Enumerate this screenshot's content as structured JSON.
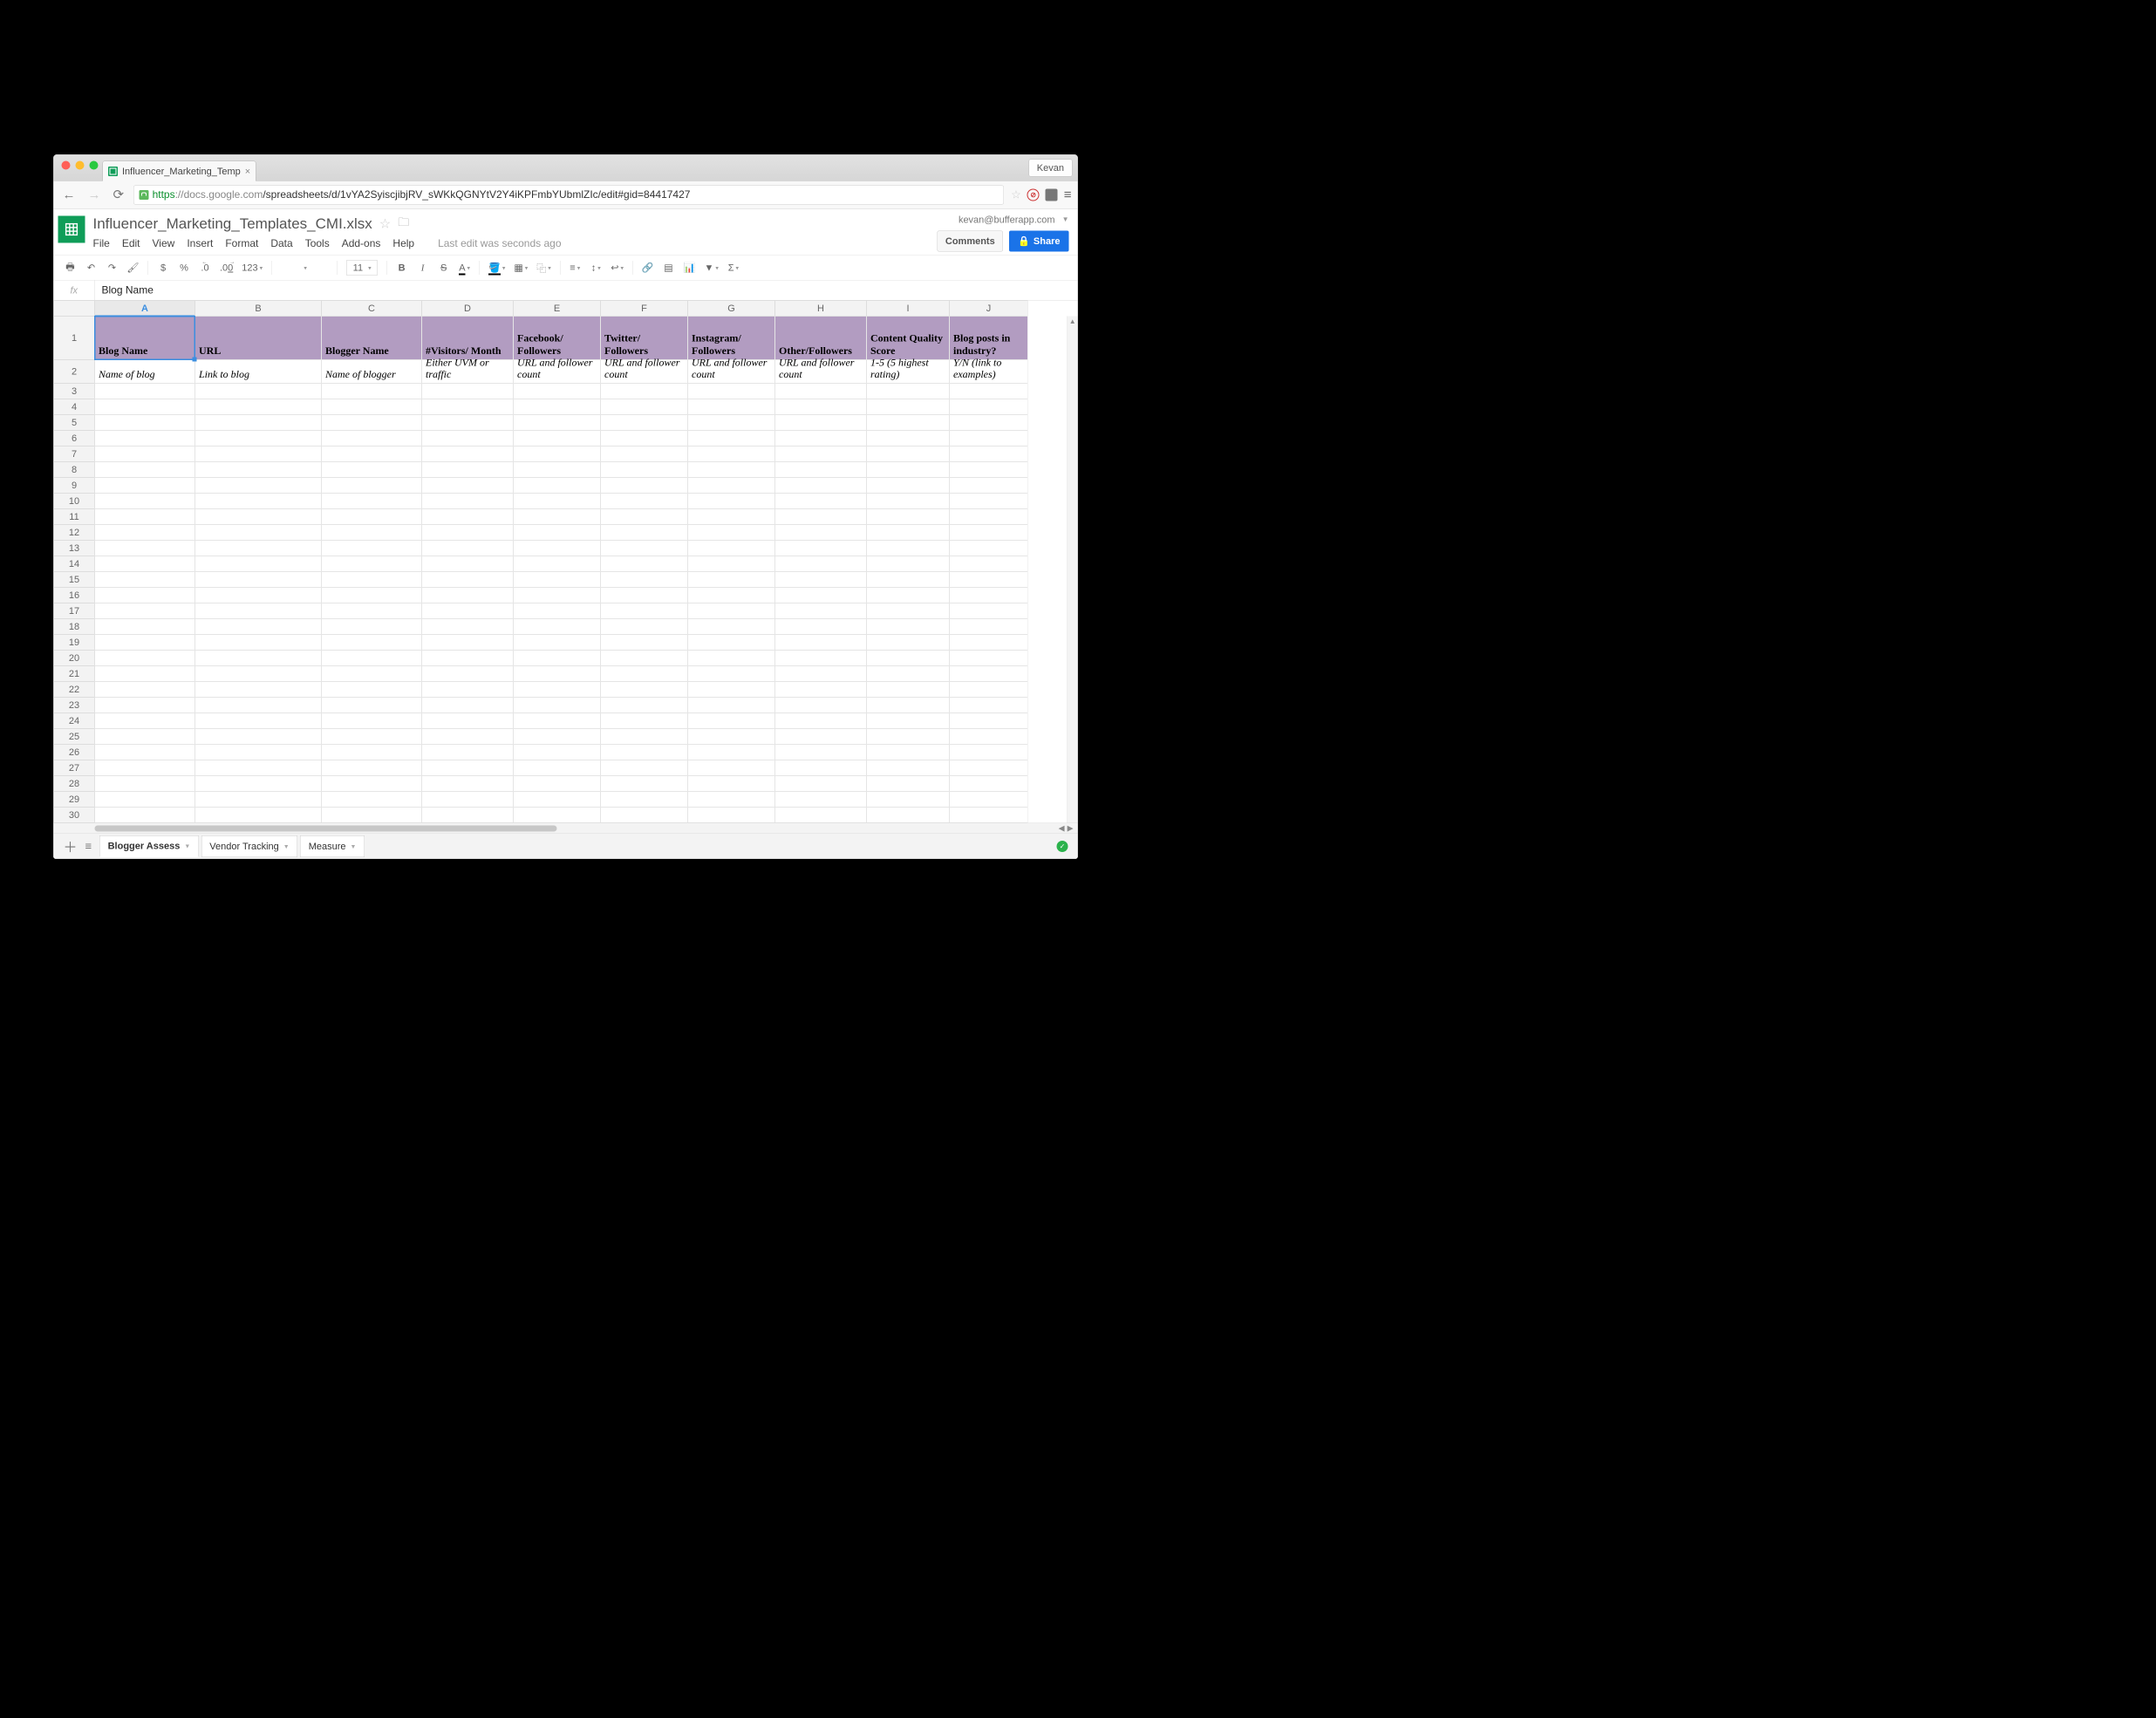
{
  "chrome": {
    "tab_title": "Influencer_Marketing_Temp",
    "profile": "Kevan",
    "url_secure_prefix": "https",
    "url_host": "://docs.google.com",
    "url_path": "/spreadsheets/d/1vYA2SyiscjibjRV_sWKkQGNYtV2Y4iKPFmbYUbmlZIc/edit#gid=84417427"
  },
  "doc": {
    "title": "Influencer_Marketing_Templates_CMI.xlsx",
    "email": "kevan@bufferapp.com",
    "comments": "Comments",
    "share": "Share",
    "last_edit": "Last edit was seconds ago"
  },
  "menu": [
    "File",
    "Edit",
    "View",
    "Insert",
    "Format",
    "Data",
    "Tools",
    "Add-ons",
    "Help"
  ],
  "toolbar": {
    "dollar": "$",
    "percent": "%",
    "dec_dec": ".0",
    "dec_inc": ".00",
    "num": "123",
    "font_size": "11",
    "bold": "B",
    "italic": "I",
    "strike": "S",
    "textA": "A",
    "sigma": "Σ"
  },
  "fx": {
    "label": "fx",
    "value": "Blog Name"
  },
  "columns": [
    "A",
    "B",
    "C",
    "D",
    "E",
    "F",
    "G",
    "H",
    "I",
    "J"
  ],
  "headers": [
    "Blog Name",
    "URL",
    "Blogger Name",
    "#Visitors/ Month",
    "Facebook/ Followers",
    "Twitter/ Followers",
    "Instagram/ Followers",
    "Other/Followers",
    "Content Quality Score",
    "Blog posts in industry?"
  ],
  "desc": [
    "Name of blog",
    "Link to blog",
    "Name of blogger",
    "Either UVM or traffic",
    "URL and follower count",
    "URL and follower count",
    "URL and follower count",
    "URL and follower count",
    "1-5 (5 highest rating)",
    "Y/N (link to examples)"
  ],
  "row_count": 30,
  "sheets": {
    "active": "Blogger Assess",
    "tabs": [
      "Blogger Assess",
      "Vendor Tracking",
      "Measure"
    ]
  }
}
